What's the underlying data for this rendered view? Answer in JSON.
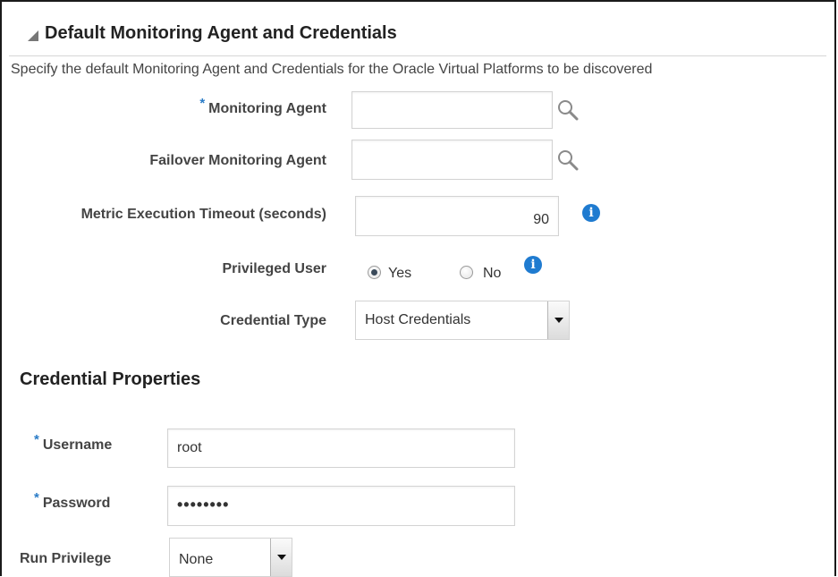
{
  "section": {
    "title": "Default Monitoring Agent and Credentials",
    "description": "Specify the default Monitoring Agent and Credentials for the Oracle Virtual Platforms to be discovered"
  },
  "fields": {
    "monitoring_agent": {
      "required_marker": "*",
      "label": "Monitoring Agent",
      "value": ""
    },
    "failover_agent": {
      "label": "Failover Monitoring Agent",
      "value": ""
    },
    "timeout": {
      "label": "Metric Execution Timeout (seconds)",
      "value": "90"
    },
    "privileged_user": {
      "label": "Privileged User",
      "options": [
        "Yes",
        "No"
      ],
      "selected": "Yes"
    },
    "credential_type": {
      "label": "Credential Type",
      "value": "Host Credentials"
    }
  },
  "credential_properties": {
    "title": "Credential Properties",
    "username": {
      "required_marker": "*",
      "label": "Username",
      "value": "root"
    },
    "password": {
      "required_marker": "*",
      "label": "Password",
      "value": "••••••••"
    },
    "run_privilege": {
      "label": "Run Privilege",
      "value": "None"
    }
  },
  "icons": {
    "search": "search-icon",
    "info": "info-icon",
    "info_glyph": "i",
    "disclosure": "disclosure-triangle-icon"
  },
  "colors": {
    "required": "#2a7cc7",
    "info": "#1f7bd0",
    "border": "#d3d3d3"
  }
}
